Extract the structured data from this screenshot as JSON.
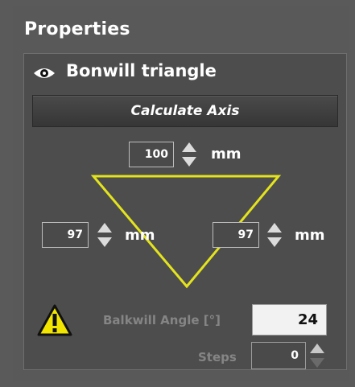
{
  "panel": {
    "title": "Properties"
  },
  "group": {
    "title": "Bonwill triangle",
    "visibility_icon": "eye-icon"
  },
  "calculate_button": {
    "label": "Calculate Axis"
  },
  "triangle": {
    "top_length": {
      "value": "100",
      "unit": "mm"
    },
    "left_length": {
      "value": "97",
      "unit": "mm"
    },
    "right_length": {
      "value": "97",
      "unit": "mm"
    },
    "line_color": "#e3e31e"
  },
  "warning": {
    "icon": "warning-icon"
  },
  "balkwill_angle": {
    "label": "Balkwill Angle [°]",
    "value": "24"
  },
  "steps": {
    "label": "Steps",
    "value": "0"
  }
}
